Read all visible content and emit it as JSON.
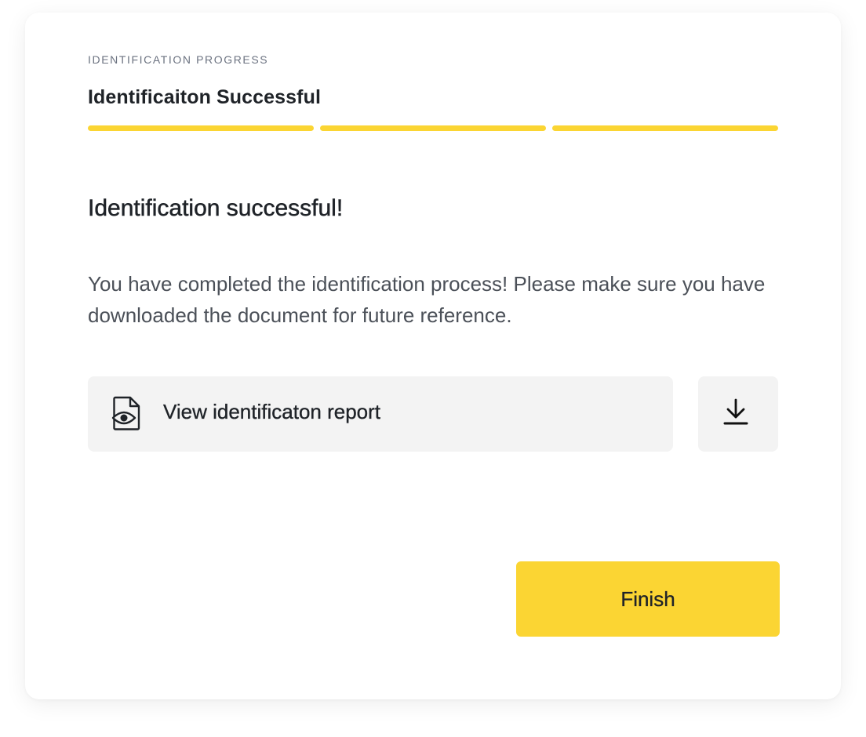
{
  "progress": {
    "label": "IDENTIFICATION PROGRESS",
    "title": "Identificaiton Successful",
    "steps_total": 3,
    "steps_completed": 3,
    "step_color": "#fbd533"
  },
  "content": {
    "heading": "Identification successful!",
    "body": "You have completed the identification process! Please make sure you have downloaded the document for future reference."
  },
  "actions": {
    "report_label": "View identificaton report",
    "report_icon": "document-eye-icon",
    "download_icon": "download-icon",
    "finish_label": "Finish"
  },
  "colors": {
    "accent": "#fbd533",
    "button_bg": "#f3f3f3",
    "text_primary": "#1f2328",
    "text_secondary": "#4b5058"
  }
}
